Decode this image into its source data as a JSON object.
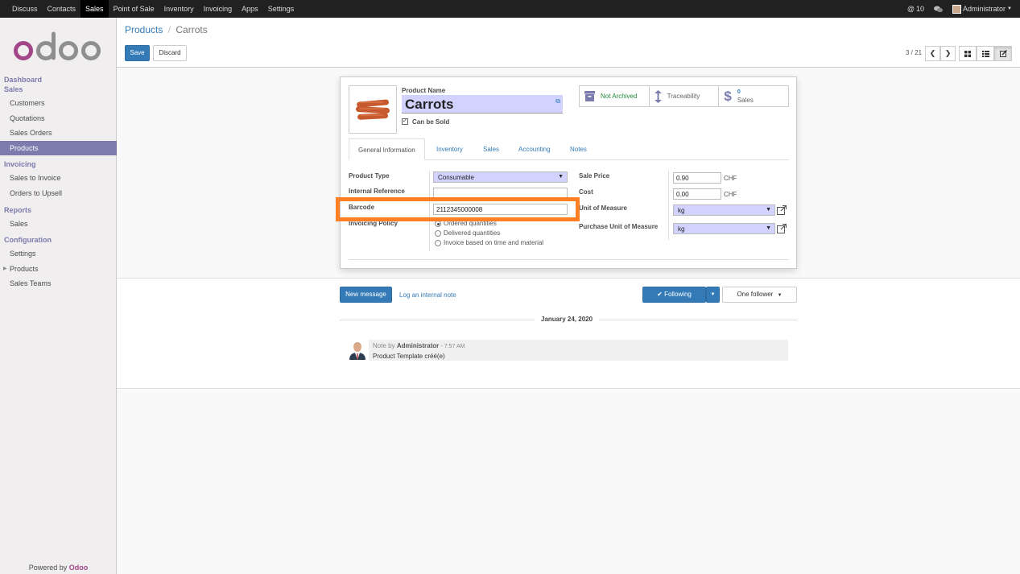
{
  "topbar": {
    "menu": [
      "Discuss",
      "Contacts",
      "Sales",
      "Point of Sale",
      "Inventory",
      "Invoicing",
      "Apps",
      "Settings"
    ],
    "active": "Sales",
    "notif_count": "10",
    "user": "Administrator"
  },
  "sidebar": {
    "sections": [
      {
        "title": "Dashboard",
        "items": []
      },
      {
        "title": "Sales",
        "items": [
          "Customers",
          "Quotations",
          "Sales Orders",
          "Products"
        ]
      },
      {
        "title": "Invoicing",
        "items": [
          "Sales to Invoice",
          "Orders to Upsell"
        ]
      },
      {
        "title": "Reports",
        "items": [
          "Sales"
        ]
      },
      {
        "title": "Configuration",
        "items": [
          "Settings",
          "Products",
          "Sales Teams"
        ]
      }
    ],
    "active_item": "Products",
    "footer_text": "Powered by",
    "footer_brand": "Odoo"
  },
  "control": {
    "breadcrumb_parent": "Products",
    "breadcrumb_sep": "/",
    "breadcrumb_current": "Carrots",
    "save": "Save",
    "discard": "Discard",
    "pager": "3 / 21"
  },
  "form": {
    "product_name_label": "Product Name",
    "product_name": "Carrots",
    "can_be_sold": "Can be Sold",
    "stats": {
      "archived": "Not Archived",
      "traceability": "Traceability",
      "sales_count": "0",
      "sales_label": "Sales"
    },
    "tabs": [
      "General Information",
      "Inventory",
      "Sales",
      "Accounting",
      "Notes"
    ],
    "active_tab": "General Information",
    "product_type_label": "Product Type",
    "product_type": "Consumable",
    "internal_ref_label": "Internal Reference",
    "internal_ref": "",
    "barcode_label": "Barcode",
    "barcode": "2112345000008",
    "invoicing_policy_label": "Invoicing Policy",
    "invoicing_options": [
      "Ordered quantities",
      "Delivered quantities",
      "Invoice based on time and material"
    ],
    "invoicing_selected": 0,
    "sale_price_label": "Sale Price",
    "sale_price": "0.90",
    "currency": "CHF",
    "cost_label": "Cost",
    "cost": "0.00",
    "uom_label": "Unit of Measure",
    "uom": "kg",
    "purchase_uom_label": "Purchase Unit of Measure",
    "purchase_uom": "kg"
  },
  "chatter": {
    "new_message": "New message",
    "log_note": "Log an internal note",
    "following": "Following",
    "followers": "One follower",
    "date": "January 24, 2020",
    "note_by": "Note by",
    "author": "Administrator",
    "time": "- 7:57 AM",
    "body": "Product Template créé(e)"
  },
  "colors": {
    "accent": "#7c7bad",
    "primary": "#337ab7",
    "highlight": "#ff7f24",
    "brand": "#a24689"
  }
}
